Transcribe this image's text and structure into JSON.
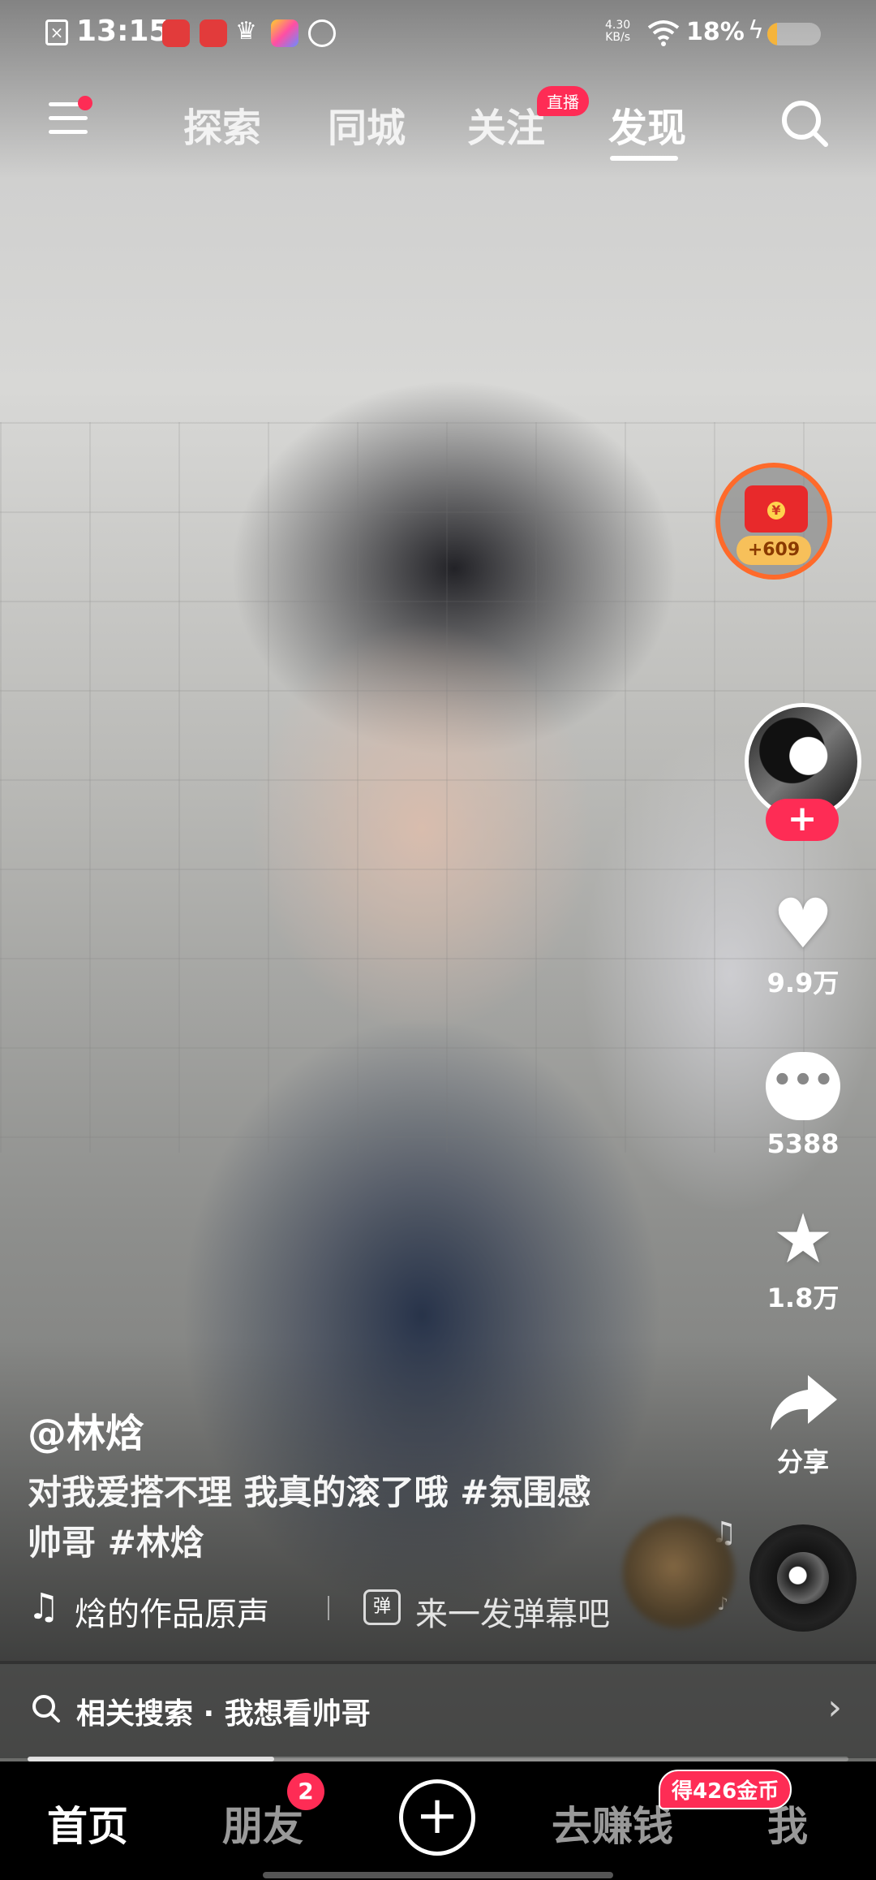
{
  "status_bar": {
    "time": "13:15",
    "net_speed": "4.30",
    "net_unit": "KB/s",
    "battery": "18%",
    "battery_level": 0.18,
    "icons": [
      "close-notification-icon",
      "app-red-icon",
      "app-red-icon",
      "crown-icon",
      "colorful-app-icon",
      "message-icon",
      "wifi-icon",
      "charging-icon",
      "battery-icon"
    ]
  },
  "top_nav": {
    "tabs": [
      {
        "label": "探索"
      },
      {
        "label": "同城"
      },
      {
        "label": "关注"
      },
      {
        "label": "发现"
      }
    ],
    "active_tab": "发现",
    "live_badge": "直播"
  },
  "sidebar": {
    "coin_reward": "+609",
    "likes": "9.9万",
    "comments": "5388",
    "favorites": "1.8万",
    "share": "分享",
    "follow_symbol": "+"
  },
  "video": {
    "author": "@林焓",
    "description_text": "对我爱搭不理 我真的滚了哦 ",
    "tag1": "#氛围感",
    "tag2_prefix": "帅哥 ",
    "tag2": "#林焓",
    "music_title": "焓的作品原声",
    "danmu_icon_text": "弹",
    "danmu_prompt": "来一发弹幕吧",
    "progress": 0.3
  },
  "related_search": {
    "label": "相关搜索 · 我想看帅哥"
  },
  "bottom_nav": {
    "home": "首页",
    "friends": "朋友",
    "friends_badge": "2",
    "create": "+",
    "earn": "去赚钱",
    "earn_badge": "得426金币",
    "me": "我"
  },
  "colors": {
    "accent": "#fe2c55",
    "coin_ring": "#ff6a2a",
    "background": "#000000"
  }
}
